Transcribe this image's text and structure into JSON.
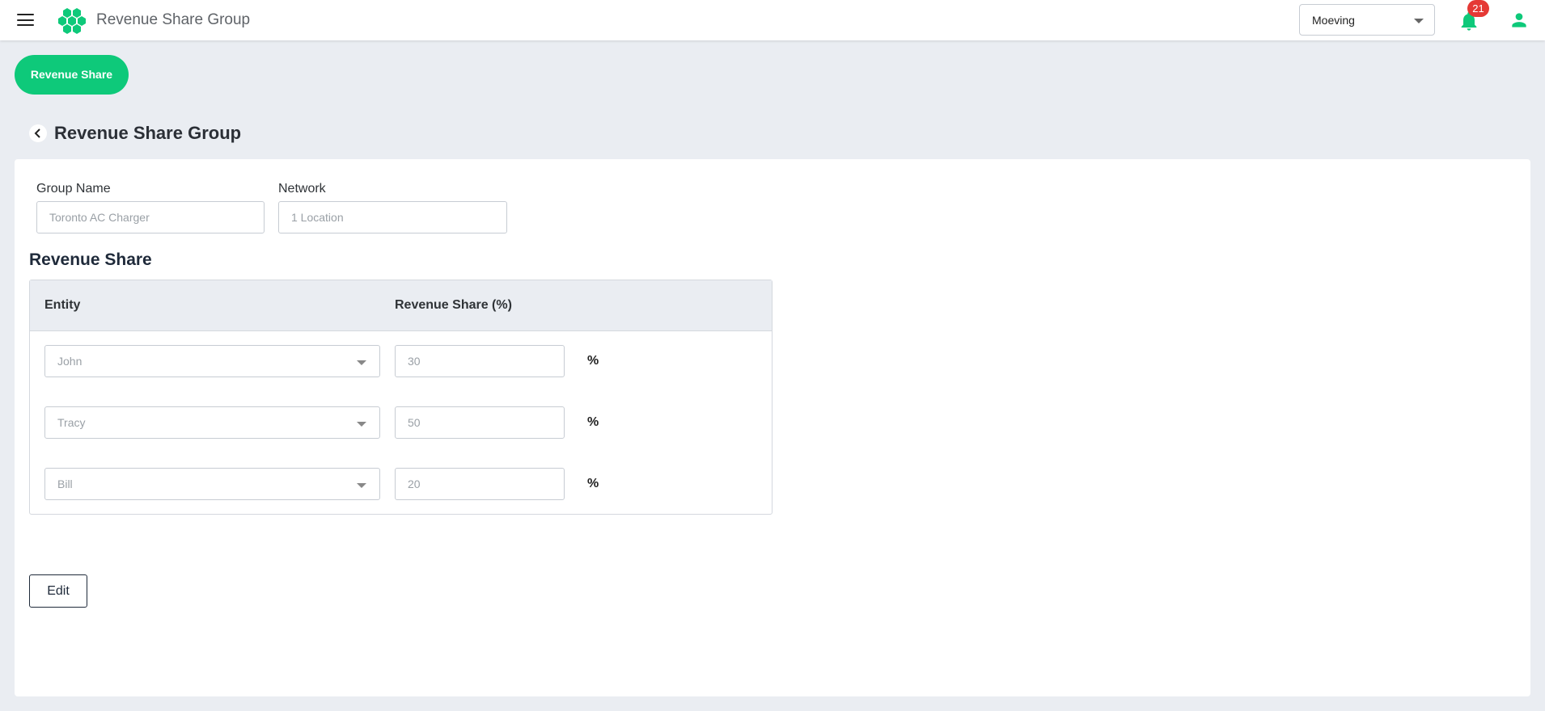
{
  "header": {
    "app_title": "Revenue Share Group",
    "org_select_value": "Moeving",
    "notification_count": "21",
    "accent_color": "#0ec97a"
  },
  "nav": {
    "pill_label": "Revenue Share"
  },
  "page": {
    "title": "Revenue Share Group"
  },
  "form": {
    "group_name_label": "Group Name",
    "group_name_placeholder": "Toronto AC Charger",
    "network_label": "Network",
    "network_placeholder": "1 Location"
  },
  "revenue_share": {
    "section_title": "Revenue Share",
    "columns": [
      "Entity",
      "Revenue Share (%)"
    ],
    "rows": [
      {
        "entity": "John",
        "share": "30",
        "unit": "%"
      },
      {
        "entity": "Tracy",
        "share": "50",
        "unit": "%"
      },
      {
        "entity": "Bill",
        "share": "20",
        "unit": "%"
      }
    ]
  },
  "actions": {
    "edit_label": "Edit"
  }
}
